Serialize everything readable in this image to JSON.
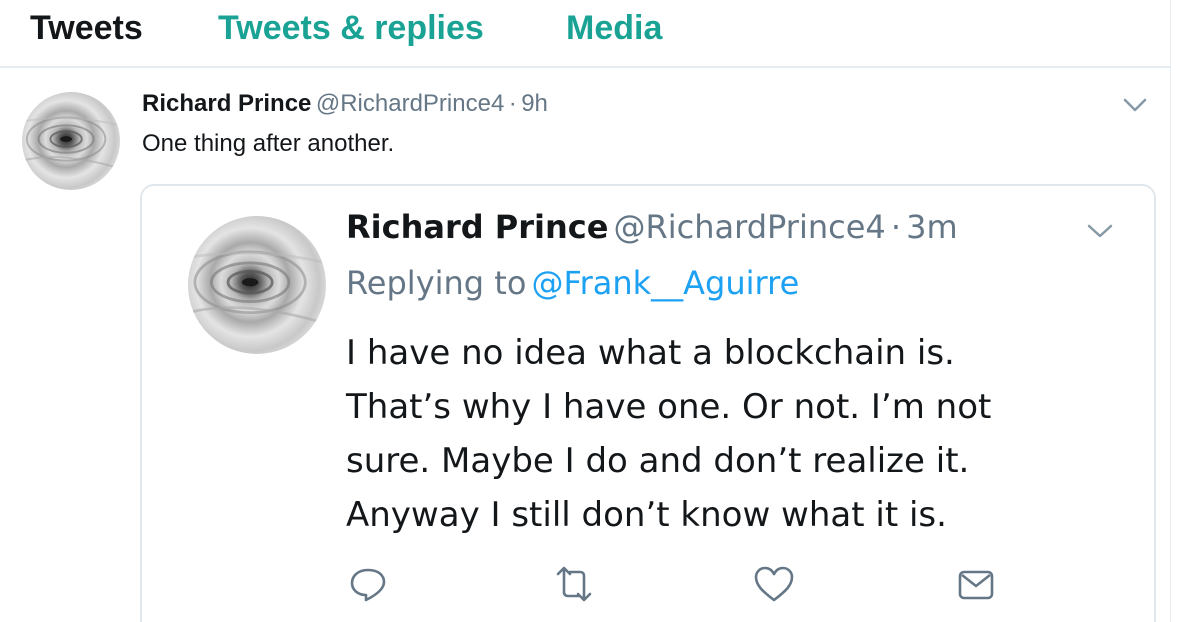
{
  "tabs": [
    {
      "label": "Tweets",
      "active": true
    },
    {
      "label": "Tweets & replies",
      "active": false
    },
    {
      "label": "Media",
      "active": false
    }
  ],
  "tweet": {
    "name": "Richard Prince",
    "handle": "@RichardPrince4",
    "sep": "·",
    "time": "9h",
    "text": "One thing after another."
  },
  "quoted": {
    "name": "Richard Prince",
    "handle": "@RichardPrince4",
    "sep": "·",
    "time": "3m",
    "replying_prefix": "Replying to",
    "replying_to": "@Frank__Aguirre",
    "lines": [
      "I have no idea what a blockchain is.",
      "That’s why I have one. Or not. I’m not",
      "sure. Maybe I do and don’t realize it.",
      "Anyway I still don’t know what it is."
    ]
  },
  "colors": {
    "accent": "#1aa394",
    "link": "#1da1f2",
    "muted": "#657786",
    "border": "#e1e8ed"
  },
  "icons": [
    "reply-icon",
    "retweet-icon",
    "like-icon",
    "message-icon",
    "chevron-down-icon"
  ]
}
